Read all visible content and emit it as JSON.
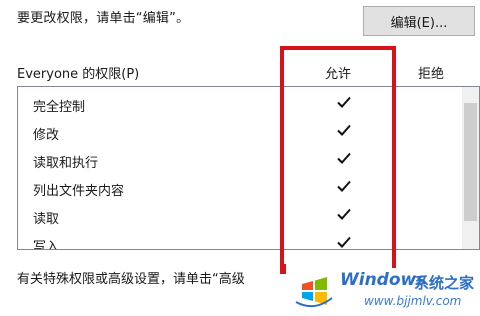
{
  "hint": "要更改权限，请单击“编辑”。",
  "edit_button": "编辑(E)...",
  "permissions_header": "Everyone 的权限(P)",
  "columns": {
    "allow": "允许",
    "deny": "拒绝"
  },
  "permissions": [
    {
      "label": "完全控制",
      "allow": true,
      "deny": false
    },
    {
      "label": "修改",
      "allow": true,
      "deny": false
    },
    {
      "label": "读取和执行",
      "allow": true,
      "deny": false
    },
    {
      "label": "列出文件夹内容",
      "allow": true,
      "deny": false
    },
    {
      "label": "读取",
      "allow": true,
      "deny": false
    },
    {
      "label": "写入",
      "allow": true,
      "deny": false
    }
  ],
  "advanced_hint": "有关特殊权限或高级设置，请单击“高级",
  "watermark": {
    "windows": "Windows",
    "site": "系统之家",
    "url": "www.bjjmlv.com"
  },
  "colors": {
    "highlight": "#d6121b",
    "watermark": "#2d6fc6"
  }
}
